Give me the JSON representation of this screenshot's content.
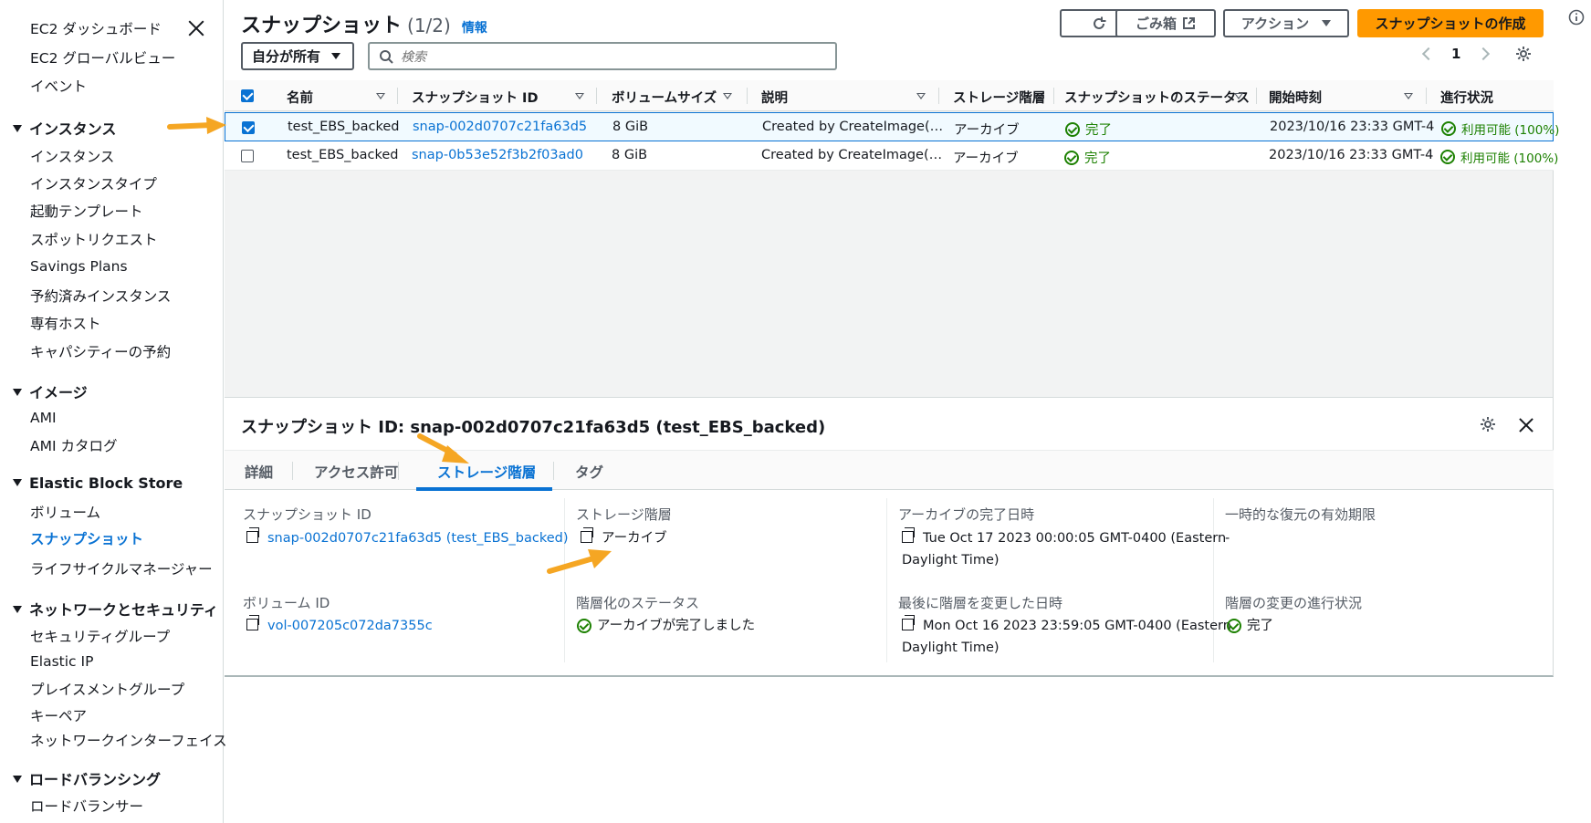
{
  "sidebar": {
    "top": [
      "EC2 ダッシュボード",
      "EC2 グローバルビュー",
      "イベント"
    ],
    "sections": [
      {
        "title": "インスタンス",
        "items": [
          "インスタンス",
          "インスタンスタイプ",
          "起動テンプレート",
          "スポットリクエスト",
          "Savings Plans",
          "予約済みインスタンス",
          "専有ホスト",
          "キャパシティーの予約"
        ]
      },
      {
        "title": "イメージ",
        "items": [
          "AMI",
          "AMI カタログ"
        ]
      },
      {
        "title": "Elastic Block Store",
        "items": [
          "ボリューム",
          "スナップショット",
          "ライフサイクルマネージャー"
        ]
      },
      {
        "title": "ネットワークとセキュリティ",
        "items": [
          "セキュリティグループ",
          "Elastic IP",
          "プレイスメントグループ",
          "キーペア",
          "ネットワークインターフェイス"
        ]
      },
      {
        "title": "ロードバランシング",
        "items": [
          "ロードバランサー"
        ]
      }
    ]
  },
  "header": {
    "title": "スナップショット",
    "count": "(1/2)",
    "info": "情報",
    "recycle_bin": "ごみ箱",
    "actions": "アクション",
    "create": "スナップショットの作成",
    "owner_filter": "自分が所有",
    "search_placeholder": "検索",
    "page": "1"
  },
  "table": {
    "columns": [
      "名前",
      "スナップショット ID",
      "ボリュームサイズ",
      "説明",
      "ストレージ階層",
      "スナップショットのステータス",
      "開始時刻",
      "進行状況"
    ],
    "rows": [
      {
        "name": "test_EBS_backed",
        "id": "snap-002d0707c21fa63d5",
        "size": "8 GiB",
        "desc": "Created by CreateImage(…",
        "tier": "アーカイブ",
        "status": "完了",
        "start": "2023/10/16 23:33 GMT-4",
        "progress": "利用可能 (100%)"
      },
      {
        "name": "test_EBS_backed",
        "id": "snap-0b53e52f3b2f03ad0",
        "size": "8 GiB",
        "desc": "Created by CreateImage(…",
        "tier": "アーカイブ",
        "status": "完了",
        "start": "2023/10/16 23:33 GMT-4",
        "progress": "利用可能 (100%)"
      }
    ]
  },
  "detail": {
    "title": "スナップショット ID: snap-002d0707c21fa63d5 (test_EBS_backed)",
    "tabs": [
      "詳細",
      "アクセス許可",
      "ストレージ階層",
      "タグ"
    ],
    "fields": {
      "snapshot_id_label": "スナップショット ID",
      "snapshot_id": "snap-002d0707c21fa63d5 (test_EBS_backed)",
      "volume_id_label": "ボリューム ID",
      "volume_id": "vol-007205c072da7355c",
      "tier_label": "ストレージ階層",
      "tier": "アーカイブ",
      "tier_status_label": "階層化のステータス",
      "tier_status": "アーカイブが完了しました",
      "archive_done_label": "アーカイブの完了日時",
      "archive_done_1": "Tue Oct 17 2023 00:00:05 GMT-0400 (Eastern",
      "archive_done_2": "Daylight Time)",
      "last_change_label": "最後に階層を変更した日時",
      "last_change_1": "Mon Oct 16 2023 23:59:05 GMT-0400 (Eastern",
      "last_change_2": "Daylight Time)",
      "temp_restore_label": "一時的な復元の有効期限",
      "temp_restore": "-",
      "change_progress_label": "階層の変更の進行状況",
      "change_progress": "完了"
    }
  },
  "colors": {
    "accent": "#0972d3",
    "primary_button": "#ff9900",
    "success": "#1d8102",
    "annotation_arrow": "#f5a623"
  }
}
